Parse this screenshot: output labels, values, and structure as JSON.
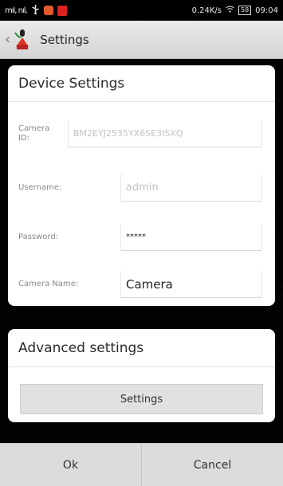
{
  "status_bar": {
    "signal_text": "mıl, nıl,",
    "usb_icon": "usb-icon",
    "network_speed": "0.24K/s",
    "battery_level": "58",
    "time": "09:04"
  },
  "title_bar": {
    "back_icon": "chevron-left-icon",
    "title": "Settings"
  },
  "device_settings": {
    "header": "Device Settings",
    "camera_id": {
      "label": "Camera ID:",
      "value": "BM2EYJ2535YX6SE3ISXQ"
    },
    "username": {
      "label": "Username:",
      "value": "admin"
    },
    "password": {
      "label": "Password:",
      "value": "*****"
    },
    "camera_name": {
      "label": "Camera Name:",
      "value": "Camera"
    }
  },
  "advanced_settings": {
    "header": "Advanced settings",
    "button_label": "Settings"
  },
  "bottom_bar": {
    "ok_label": "Ok",
    "cancel_label": "Cancel"
  }
}
